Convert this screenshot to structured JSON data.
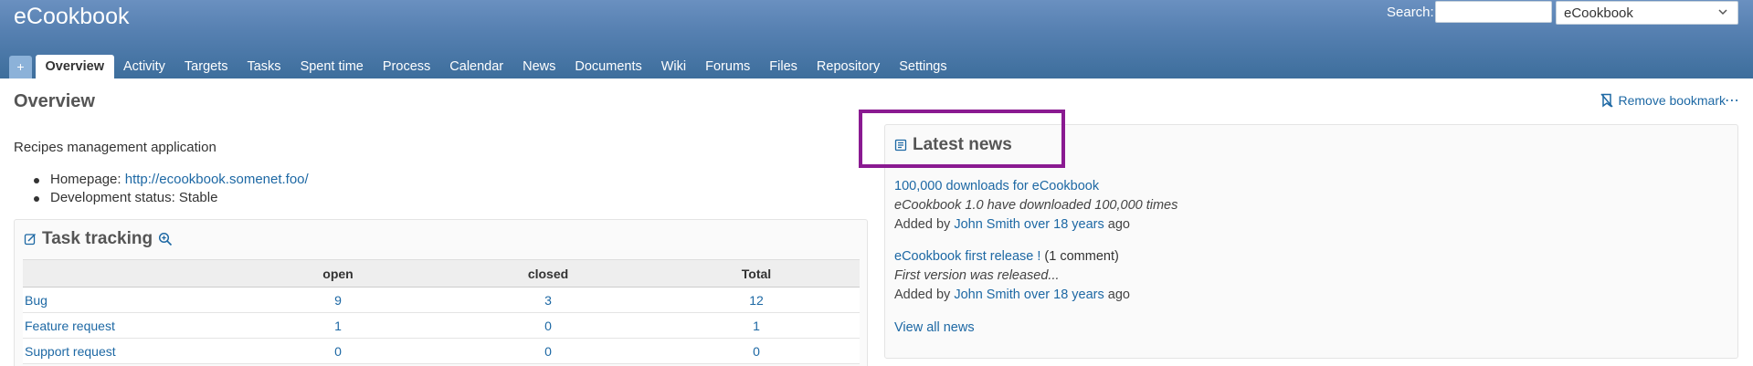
{
  "header": {
    "title": "eCookbook",
    "search_label": "Search:",
    "search_value": "",
    "project_select": "eCookbook"
  },
  "menu": {
    "new_label": "+",
    "tabs": [
      {
        "label": "Overview",
        "selected": true
      },
      {
        "label": "Activity"
      },
      {
        "label": "Targets"
      },
      {
        "label": "Tasks"
      },
      {
        "label": "Spent time"
      },
      {
        "label": "Process"
      },
      {
        "label": "Calendar"
      },
      {
        "label": "News"
      },
      {
        "label": "Documents"
      },
      {
        "label": "Wiki"
      },
      {
        "label": "Forums"
      },
      {
        "label": "Files"
      },
      {
        "label": "Repository"
      },
      {
        "label": "Settings"
      }
    ]
  },
  "page": {
    "title": "Overview",
    "description": "Recipes management application",
    "homepage_label": "Homepage:",
    "homepage_url": "http://ecookbook.somenet.foo/",
    "status_label": "Development status:",
    "status_value": "Stable",
    "bookmark_label": "Remove bookmark",
    "more_label": "⋯"
  },
  "task_tracking": {
    "title": "Task tracking",
    "columns": [
      "",
      "open",
      "closed",
      "Total"
    ],
    "rows": [
      {
        "tracker": "Bug",
        "open": "9",
        "closed": "3",
        "total": "12"
      },
      {
        "tracker": "Feature request",
        "open": "1",
        "closed": "0",
        "total": "1"
      },
      {
        "tracker": "Support request",
        "open": "0",
        "closed": "0",
        "total": "0"
      }
    ]
  },
  "news": {
    "title": "Latest news",
    "items": [
      {
        "title": "100,000 downloads for eCookbook",
        "comments": "",
        "summary": "eCookbook 1.0 have downloaded 100,000 times",
        "added_by": "Added by",
        "author": "John Smith",
        "age": "over 18 years",
        "ago": "ago"
      },
      {
        "title": "eCookbook first release !",
        "comments": "(1 comment)",
        "summary": "First version was released...",
        "added_by": "Added by",
        "author": "John Smith",
        "age": "over 18 years",
        "ago": "ago"
      }
    ],
    "view_all": "View all news"
  },
  "colors": {
    "header_top": "#6a90c0",
    "header_bottom": "#3d6e9c",
    "link": "#1d68a4",
    "highlight": "#8a1a91"
  }
}
